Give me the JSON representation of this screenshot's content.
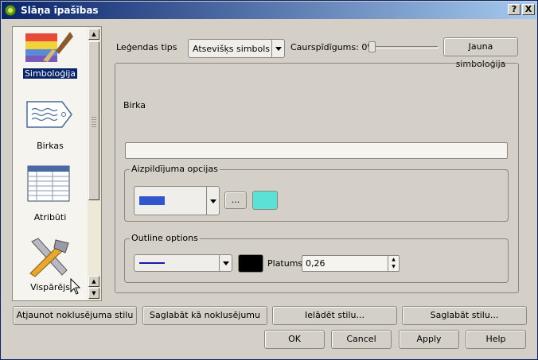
{
  "window": {
    "title": "Slāņa īpašības",
    "help_label": "?",
    "close_label": "X"
  },
  "sidebar": {
    "items": [
      {
        "label": "Simboloģija",
        "icon": "symbology-brush-icon",
        "selected": true
      },
      {
        "label": "Birkas",
        "icon": "label-tag-icon",
        "selected": false
      },
      {
        "label": "Atribūti",
        "icon": "attribute-table-icon",
        "selected": false
      },
      {
        "label": "Vispārējs",
        "icon": "tools-icon",
        "selected": false
      }
    ]
  },
  "legend": {
    "label": "Leģendas tips",
    "selected": "Atsevišķs simbols",
    "transparency_label": "Caurspīdīgums: 0%",
    "transparency_value": 0,
    "new_symbology_label": "Jauna simboloģija"
  },
  "panel": {
    "label_caption": "Birka",
    "label_value": "",
    "fill_group_title": "Aizpildījuma opcijas",
    "fill_color": "#3355cc",
    "fill_more_label": "...",
    "fill_swatch_color": "#5ce1d6",
    "outline_group_title": "Outline options",
    "outline_color": "#1a1aaa",
    "outline_swatch_color": "#000000",
    "width_label": "Platums",
    "width_value": "0,26"
  },
  "bottom_buttons": {
    "restore_default": "Atjaunot noklusējuma stilu",
    "save_default": "Saglabāt kā noklusējumu",
    "load_style": "Ielādēt stilu...",
    "save_style": "Saglabāt stilu..."
  },
  "dialog_buttons": {
    "ok": "OK",
    "cancel": "Cancel",
    "apply": "Apply",
    "help": "Help"
  }
}
